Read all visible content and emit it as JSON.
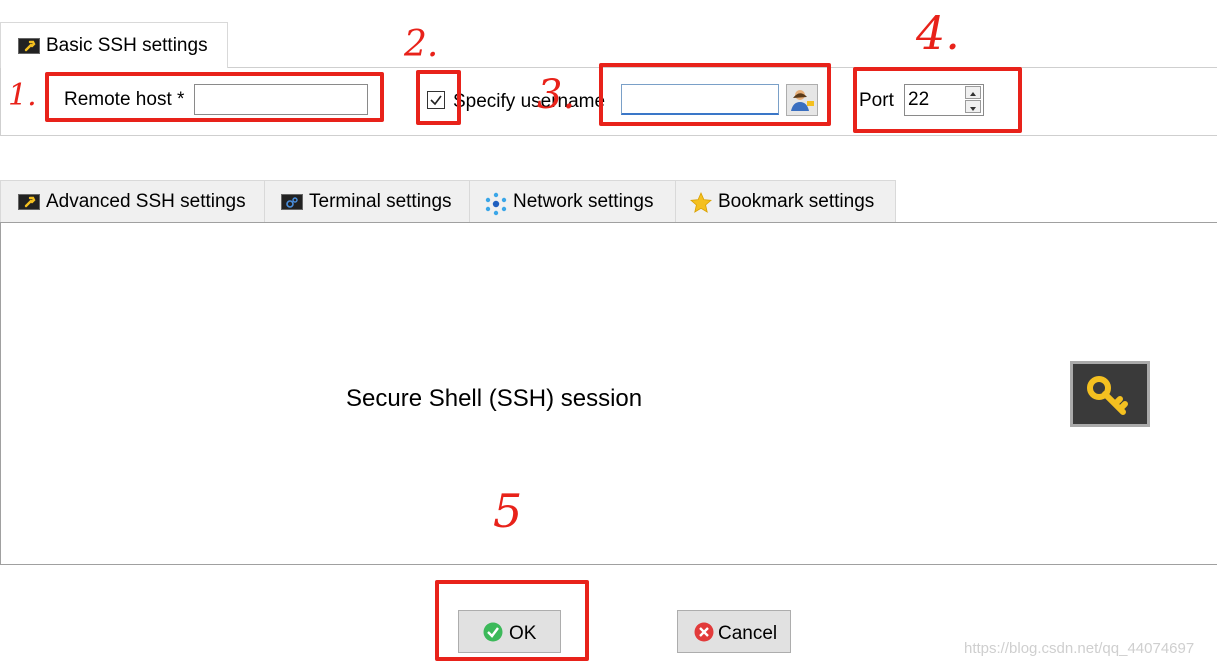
{
  "basic_tab": {
    "label": "Basic SSH settings",
    "icon": "wrench-icon"
  },
  "remote_host": {
    "label": "Remote host *",
    "value": ""
  },
  "specify_username": {
    "label": "Specify username",
    "checked": true,
    "value": ""
  },
  "port": {
    "label": "Port",
    "value": "22"
  },
  "tabs": [
    {
      "label": "Advanced SSH settings",
      "icon": "wrench-icon"
    },
    {
      "label": "Terminal settings",
      "icon": "terminal-gear-icon"
    },
    {
      "label": "Network settings",
      "icon": "network-icon"
    },
    {
      "label": "Bookmark settings",
      "icon": "star-icon"
    }
  ],
  "session": {
    "title": "Secure Shell (SSH) session",
    "icon": "key-icon"
  },
  "buttons": {
    "ok": "OK",
    "cancel": "Cancel"
  },
  "annotations": {
    "n1": "1.",
    "n2": "2.",
    "n3": "3.",
    "n4": "4.",
    "n5": "5"
  },
  "watermark": "https://blog.csdn.net/qq_44074697",
  "colors": {
    "annotation_red": "#e8221a",
    "ok_green": "#3cb95a",
    "cancel_red": "#e23b3b",
    "key_gold": "#f4c020"
  }
}
